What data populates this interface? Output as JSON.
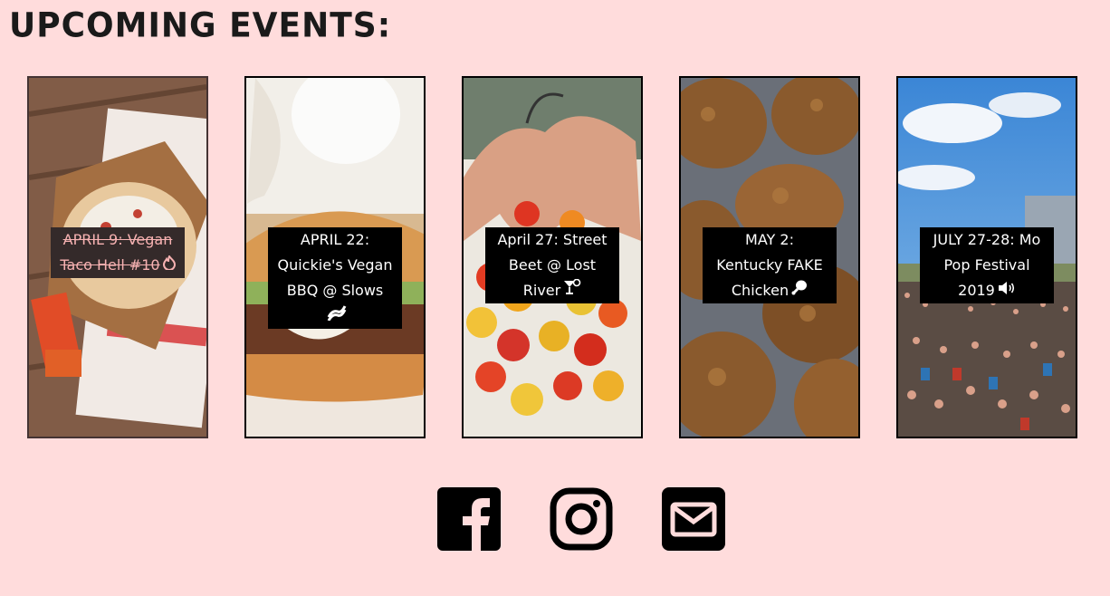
{
  "heading": "UPCOMING EVENTS:",
  "events": [
    {
      "title": "APRIL 9: Vegan Taco Hell #10",
      "icon": "fire-icon",
      "past": true
    },
    {
      "title": "APRIL 22: Quickie's Vegan BBQ @ Slows",
      "icon": "bacon-icon",
      "past": false
    },
    {
      "title": "April 27: Street Beet @ Lost River",
      "icon": "cocktail-icon",
      "past": false
    },
    {
      "title": "MAY 2: Kentucky FAKE Chicken",
      "icon": "drumstick-icon",
      "past": false
    },
    {
      "title": "JULY 27-28: Mo Pop Festival 2019",
      "icon": "speaker-icon",
      "past": false
    }
  ],
  "social": [
    "facebook-icon",
    "instagram-icon",
    "email-icon"
  ],
  "colors": {
    "background": "#ffdcdc",
    "card_border": "#000000",
    "label_bg": "#000000",
    "label_text": "#ffffff",
    "past_label_text": "#f7b0b0"
  }
}
